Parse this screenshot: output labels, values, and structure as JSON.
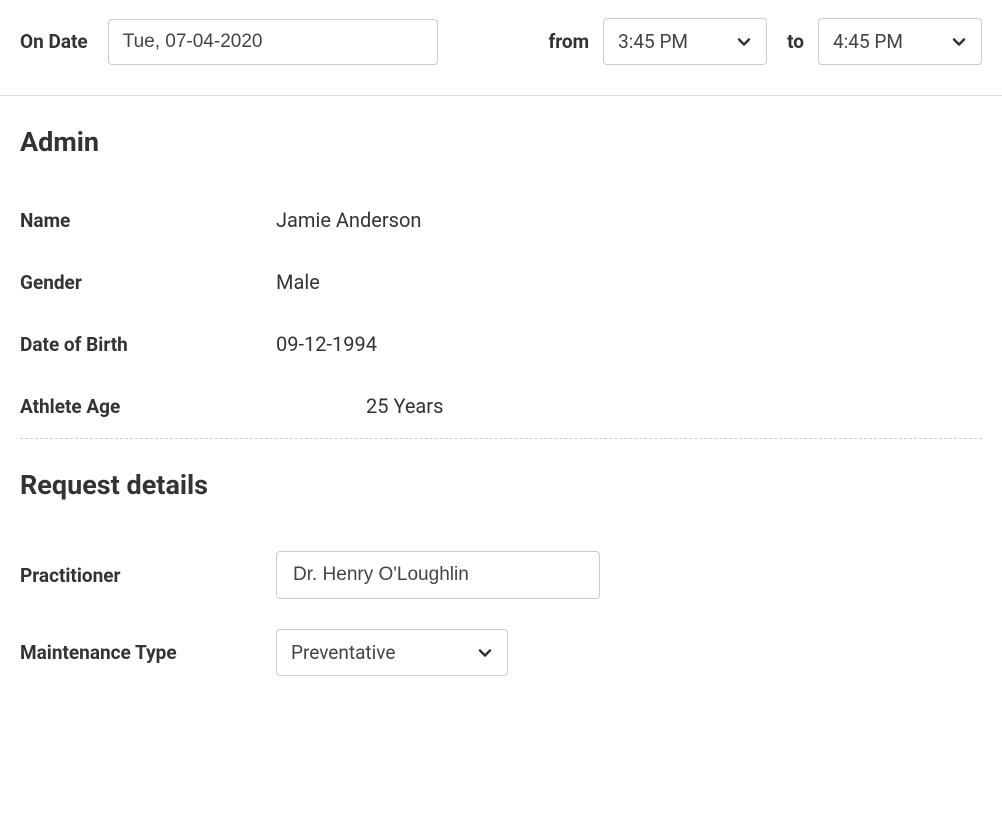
{
  "dateRow": {
    "onDateLabel": "On Date",
    "onDateValue": "Tue, 07-04-2020",
    "fromLabel": "from",
    "fromValue": "3:45 PM",
    "toLabel": "to",
    "toValue": "4:45 PM"
  },
  "admin": {
    "title": "Admin",
    "nameLabel": "Name",
    "nameValue": "Jamie Anderson",
    "genderLabel": "Gender",
    "genderValue": "Male",
    "dobLabel": "Date of Birth",
    "dobValue": "09-12-1994",
    "ageLabel": "Athlete Age",
    "ageValue": "25 Years"
  },
  "request": {
    "title": "Request details",
    "practitionerLabel": "Practitioner",
    "practitionerValue": "Dr. Henry O'Loughlin",
    "maintenanceLabel": "Maintenance Type",
    "maintenanceValue": "Preventative"
  }
}
